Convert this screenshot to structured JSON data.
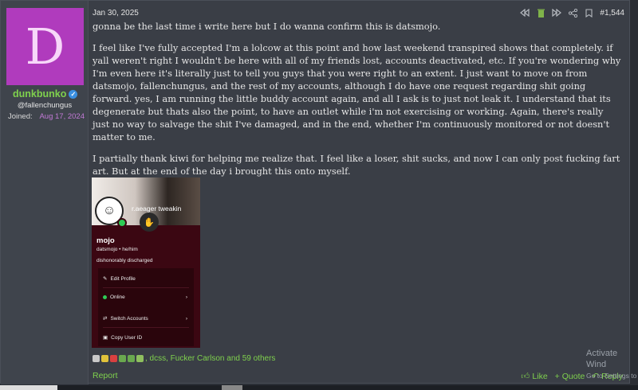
{
  "user": {
    "avatar_letter": "D",
    "avatar_color": "#b03bbd",
    "username": "dunkbunko",
    "verified_icon": "verified-check-icon",
    "handle": "@fallenchungus",
    "joined_label": "Joined:",
    "joined_date": "Aug 17, 2024"
  },
  "post": {
    "date": "Jan 30, 2025",
    "number": "#1,544",
    "paragraphs": [
      "gonna be the last time i write here but I do wanna confirm this is datsmojo.",
      "I feel like I've fully accepted I'm a lolcow at this point and how last weekend transpired shows that completely. if yall weren't right I wouldn't be here with all of my friends lost, accounts deactivated, etc. If you're wondering why I'm even here it's literally just to tell you guys that you were right to an extent. I just want to move on from datsmojo, fallenchungus, and the rest of my accounts, although I do have one request regarding shit going forward. yes, I am running the little buddy account again, and all I ask is to just not leak it. I understand that its degenerate but thats also the point, to have an outlet while i'm not exercising or working. Again, there's really just no way to salvage the shit I've damaged, and in the end, whether I'm continuously monitored or not doesn't matter to me.",
      "I partially thank kiwi for helping me realize that. I feel like a loser, shit sucks, and now I can only post fucking fart art. But at the end of the day i brought this onto myself."
    ]
  },
  "attachment": {
    "banner_text": "r.aeager tweakin",
    "profile_name": "mojo",
    "profile_meta": "datsmojo • he/him",
    "profile_status": "dishonorably discharged",
    "menu": [
      "Edit Profile",
      "Online",
      "Switch Accounts",
      "Copy User ID"
    ]
  },
  "reactions": {
    "text": ", dcss, Fucker Carlson and 59 others"
  },
  "footer": {
    "report": "Report",
    "like": "Like",
    "quote": "+ Quote",
    "reply": "Reply"
  },
  "watermark": {
    "title": "Activate Wind",
    "sub": "Go to Settings to"
  },
  "colors": {
    "accent_green": "#7fd14d",
    "joined_purple": "#c27ad6",
    "post_bg": "#3a3e46"
  }
}
